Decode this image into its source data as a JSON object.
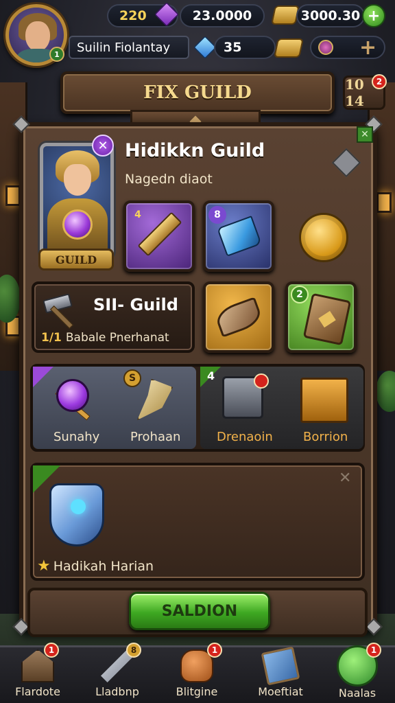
{
  "top_bar": {
    "avatar_level": "1",
    "level": "220",
    "gems": "23.0000",
    "ingots": "3000.30",
    "player_name": "Suilin Fiolantay",
    "crystals": "35",
    "plus_symbol": "+"
  },
  "header": {
    "title": "FIX GUILD",
    "side_counter": "10 14",
    "side_notif": "2"
  },
  "guild": {
    "name": "Hidikkn Guild",
    "subtitle": "Nagedn diaot",
    "plate_label": "GUILD",
    "hero_mark": "✕"
  },
  "slots_row1": [
    {
      "num": "4",
      "item": "gold-sword"
    },
    {
      "num": "8",
      "item": "blue-crystal"
    },
    {
      "num": "",
      "item": "gold-coin"
    }
  ],
  "feature_card": {
    "title": "SII- Guild",
    "count": "1/1",
    "desc": "Babale Pnerhanat"
  },
  "slots_row2": [
    {
      "num": "",
      "item": "leaf-token"
    },
    {
      "num": "2",
      "item": "rune-book"
    }
  ],
  "row3": [
    {
      "label": "Sunahy",
      "item": "purple-mace"
    },
    {
      "label": "Prohaan",
      "item": "bone-axe",
      "badge": "S"
    },
    {
      "label": "Drenaoin",
      "item": "steel-safe",
      "badge": "4"
    },
    {
      "label": "Borrion",
      "item": "gold-crates"
    }
  ],
  "featured_item": {
    "label": "Hadikah Harian",
    "item": "crystal-shield"
  },
  "action": {
    "button_label": "SALDION"
  },
  "bottom_nav": [
    {
      "label": "Flardote",
      "icon": "house-icon",
      "badge": "1"
    },
    {
      "label": "Lladbnp",
      "icon": "sword-icon",
      "badge": "8"
    },
    {
      "label": "Blitgine",
      "icon": "pot-icon",
      "badge": "1"
    },
    {
      "label": "Moeftiat",
      "icon": "book-icon",
      "badge": ""
    },
    {
      "label": "Naalas",
      "icon": "circle-icon",
      "badge": "1"
    }
  ],
  "colors": {
    "accent_gold": "#f5d98e",
    "action_green": "#3ea822",
    "badge_red": "#d4231c",
    "panel_brown": "#4a3628"
  }
}
